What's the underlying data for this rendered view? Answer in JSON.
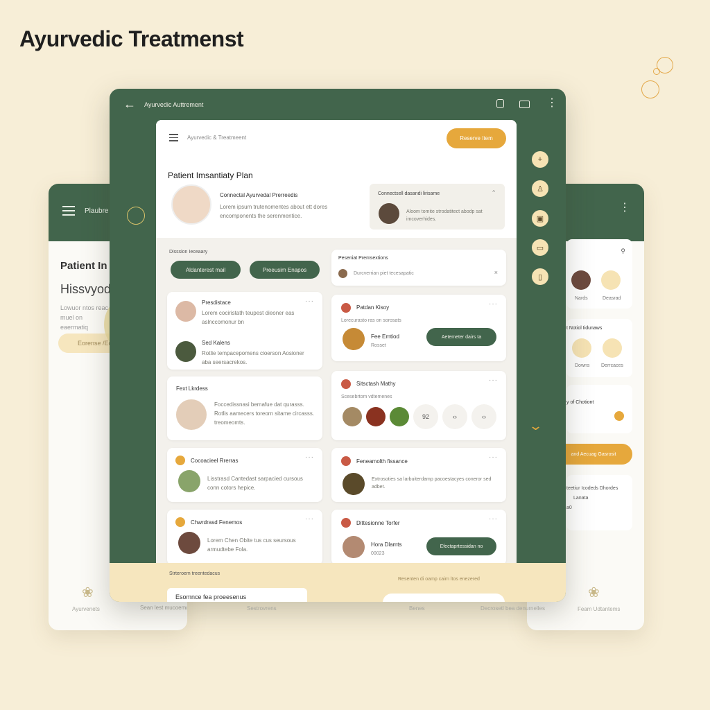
{
  "page_title": "Ayurvedic Treatmenst",
  "tablet": {
    "topbar_title": "Ayurvedic Auttrement",
    "breadcrumb": "Ayurvedic & Treatmeent",
    "action_button": "Reserve Item",
    "plan_title": "Patient Imsantiaty Plan",
    "profile": {
      "name": "Connectal Ayurvedal Prerreedis",
      "desc": "Lorem ipsum trutenomentes about ett dores encomponents the serenmentice."
    },
    "consult_card": {
      "title": "Connectsell dasandi lirisame",
      "desc": "Aloom tomite strodatitect abodp sat imcoverhides."
    },
    "filters_label": "Disssion Ieceaary",
    "filter_buttons": [
      "Aldanterest mail",
      "Preeusim Enapos"
    ],
    "search_card": {
      "title": "Peseniat Premsextions",
      "desc": "Durcverrian piet tecesapatic"
    },
    "left_cards": [
      {
        "title": "Presdistace",
        "desc": "Lorem cociristath teupest dieoner eas aslnccomonur bn",
        "name2": "Sed Kalens",
        "desc2": "Rotlie tempacepomens cioerson Aosioner aba seersacrekos."
      },
      {
        "title": "Fext Lkrdess",
        "desc": "Foccedissnasi bemafue dat qurasss. Rotlis aamecers toreorn sitame circasss. treomeomts."
      },
      {
        "title": "Cocoacieel Rrerras",
        "desc": "Lisstrasd Cantedast sarpacied cursous conn cotors hepice."
      },
      {
        "title": "Chwrdrasd Fenemos",
        "desc": "Lorem Chen Obite tus cus seursous armudtebe Fola."
      }
    ],
    "right_cards": [
      {
        "title": "Patdan Kisoy",
        "desc": "Lorecurasto ras on sorosats",
        "item": "Fee Emtiod",
        "sub": "Rosset",
        "button": "Aetemeter dairs ta"
      },
      {
        "title": "Sitsctash Mathy",
        "desc": "Scesebrtom vdtemenes",
        "nums": [
          "92",
          "‹›",
          "‹›"
        ]
      },
      {
        "title": "Feneamolth fissance",
        "desc": "Extrosoties sa larbuiterdamp pacoestacyes coneror sed adbet."
      },
      {
        "title": "Dittesionne Torfer",
        "item": "Hora Dlamts",
        "sub": "00023",
        "button": "Efectaprtessidan no"
      }
    ],
    "footer": {
      "left_label": "Strteroem treentedacus",
      "left_card": "Esomnce fea proeesenus",
      "right_label": "Resenten di oamp cairn ltos enezered"
    }
  },
  "back_left": {
    "title": "Plaubre",
    "heading": "Patient In",
    "subheading": "Hissvyods",
    "desc": "Lowuor ntos reac muel on eaermatiq",
    "button": "Eorense /Ecn"
  },
  "back_right": {
    "people": [
      "Nards",
      "Deasrad"
    ],
    "section_title": "t Notiol Iidunaws",
    "section_people": [
      "Downs",
      "Derrcaces"
    ],
    "check_label": "y of Chotiont",
    "button": "and Aecuag Gasrosit",
    "list_title": "teetiur Icodeds Dhordes",
    "list_item": "Lanata",
    "list_num": "a0"
  },
  "bottom_nav": [
    "Ayurvenets",
    "Sean lest mucoemamabes",
    "Sestrovrens",
    "Benes",
    "Decrosetl bea denurnelles",
    "Feam Udtantems"
  ],
  "colors": {
    "primary": "#42654c",
    "accent": "#e6a83c",
    "cream": "#f7eed7"
  },
  "icons": [
    "back-arrow-icon",
    "lock-icon",
    "print-icon",
    "more-icon",
    "menu-icon",
    "lotus-icon",
    "chevron-down-icon",
    "search-icon"
  ]
}
